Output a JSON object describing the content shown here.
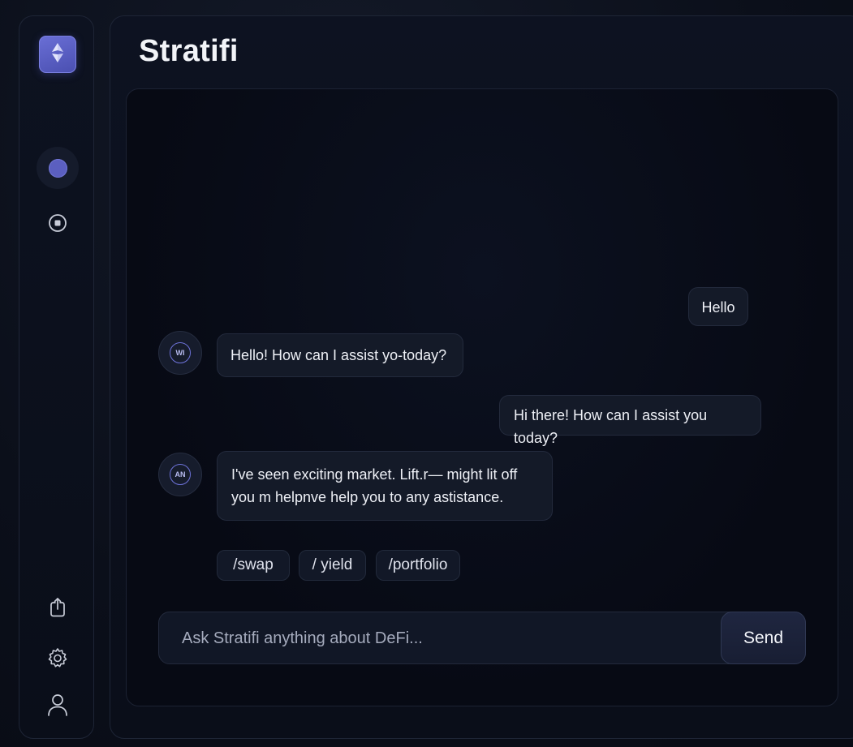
{
  "app": {
    "title": "Stratifi"
  },
  "sidebar": {
    "logo_icon": "ethereum-logo-icon",
    "items": [
      {
        "icon": "active-dot-icon",
        "active": true
      },
      {
        "icon": "stop-circle-icon",
        "active": false
      }
    ],
    "bottom_items": [
      {
        "icon": "share-icon"
      },
      {
        "icon": "settings-gear-icon"
      },
      {
        "icon": "user-profile-icon"
      }
    ]
  },
  "chat": {
    "messages": [
      {
        "role": "user",
        "text": "Hello"
      },
      {
        "role": "assistant",
        "avatar_text": "WI",
        "text": "Hello! How can I assist yo-today?"
      },
      {
        "role": "user",
        "text": "Hi there! How can I assist you today?"
      },
      {
        "role": "assistant",
        "avatar_text": "AN",
        "text_lines": [
          "I've seen exciting market. Lift.r— might lit off",
          "you m helpnve help you to any astistance."
        ]
      }
    ],
    "quick_commands": [
      "/swap",
      "/ yield",
      "/portfolio"
    ],
    "input": {
      "placeholder": "Ask Stratifi anything about DeFi...",
      "value": ""
    },
    "send_label": "Send"
  },
  "colors": {
    "accent": "#5b5fc0",
    "background": "#0b0f1a",
    "bubble": "#141a28"
  }
}
